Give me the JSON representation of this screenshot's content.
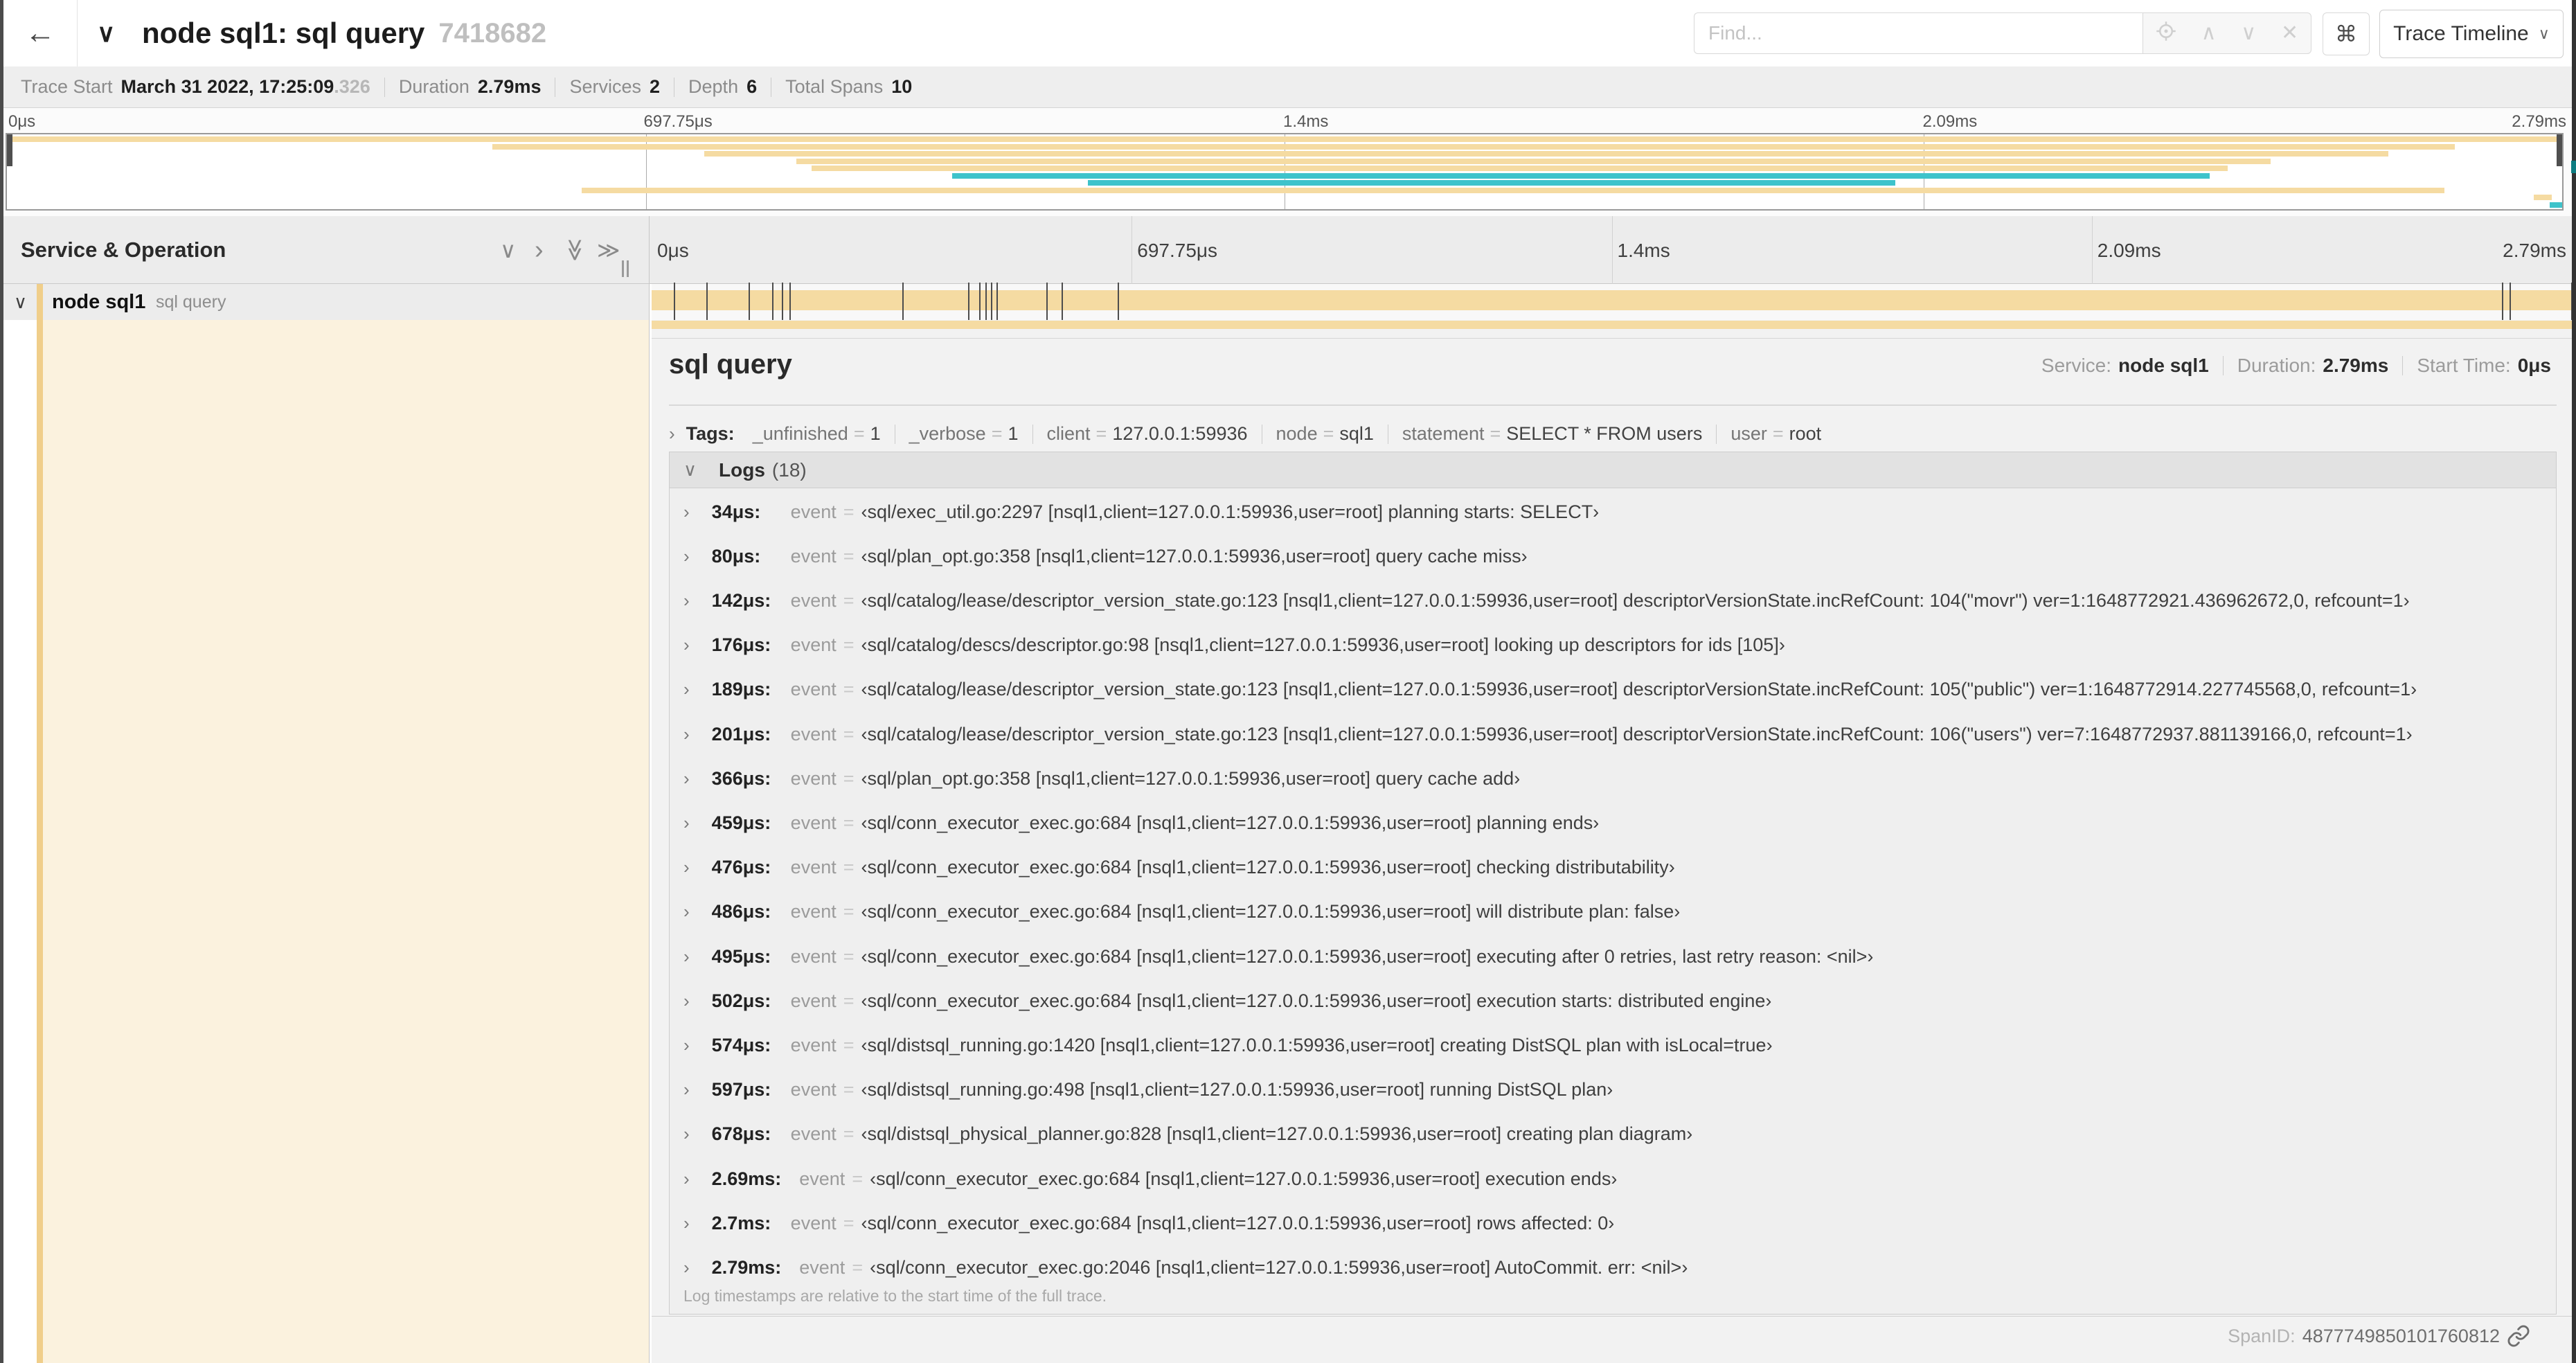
{
  "colors": {
    "tan": "#F5DBA2",
    "teal": "#3EC3CB",
    "accent_strip": "#F0CE8A",
    "detail_tint": "#FBF2DE"
  },
  "header": {
    "back_icon": "←",
    "title": "node sql1: sql query",
    "trace_id": "7418682",
    "find_placeholder": "Find...",
    "view_button_label": "Trace Timeline"
  },
  "stats": {
    "items": [
      {
        "label": "Trace Start",
        "value": "March 31 2022, 17:25:09",
        "suffix": ".326"
      },
      {
        "label": "Duration",
        "value": "2.79ms"
      },
      {
        "label": "Services",
        "value": "2"
      },
      {
        "label": "Depth",
        "value": "6"
      },
      {
        "label": "Total Spans",
        "value": "10"
      }
    ]
  },
  "ruler": {
    "ticks": [
      "0μs",
      "697.75μs",
      "1.4ms",
      "2.09ms",
      "2.79ms"
    ],
    "tick_pcts": [
      0,
      25,
      50,
      75,
      100
    ]
  },
  "minimap": {
    "spans": [
      {
        "start": 0,
        "end": 100,
        "color": "tan"
      },
      {
        "start": 19,
        "end": 95.8,
        "color": "tan"
      },
      {
        "start": 27.3,
        "end": 93.2,
        "color": "tan"
      },
      {
        "start": 30.9,
        "end": 88.6,
        "color": "tan"
      },
      {
        "start": 31.5,
        "end": 86.9,
        "color": "tan"
      },
      {
        "start": 37.0,
        "end": 86.2,
        "color": "teal"
      },
      {
        "start": 42.3,
        "end": 73.9,
        "color": "teal"
      },
      {
        "start": 22.5,
        "end": 95.4,
        "color": "tan"
      },
      {
        "start": 98.9,
        "end": 99.6,
        "color": "tan"
      },
      {
        "start": 99.5,
        "end": 100,
        "color": "teal"
      }
    ]
  },
  "panel": {
    "title": "Service & Operation"
  },
  "row": {
    "service": "node sql1",
    "operation": "sql query"
  },
  "detail": {
    "title": "sql query",
    "meta": [
      {
        "label": "Service:",
        "value": "node sql1"
      },
      {
        "label": "Duration:",
        "value": "2.79ms"
      },
      {
        "label": "Start Time:",
        "value": "0μs"
      }
    ],
    "tags_label": "Tags:",
    "tags": [
      {
        "key": "_unfinished",
        "value": "1"
      },
      {
        "key": "_verbose",
        "value": "1"
      },
      {
        "key": "client",
        "value": "127.0.0.1:59936"
      },
      {
        "key": "node",
        "value": "sql1"
      },
      {
        "key": "statement",
        "value": "SELECT * FROM users"
      },
      {
        "key": "user",
        "value": "root"
      }
    ],
    "logs_label": "Logs",
    "logs_count": "(18)",
    "logs": [
      {
        "time": "34μs:",
        "pct": 1.2,
        "field": "event",
        "value": "‹sql/exec_util.go:2297 [nsql1,client=127.0.0.1:59936,user=root] planning starts: SELECT›"
      },
      {
        "time": "80μs:",
        "pct": 2.9,
        "field": "event",
        "value": "‹sql/plan_opt.go:358 [nsql1,client=127.0.0.1:59936,user=root] query cache miss›"
      },
      {
        "time": "142μs:",
        "pct": 5.1,
        "field": "event",
        "value": "‹sql/catalog/lease/descriptor_version_state.go:123 [nsql1,client=127.0.0.1:59936,user=root] descriptorVersionState.incRefCount: 104(\"movr\") ver=1:1648772921.436962672,0, refcount=1›"
      },
      {
        "time": "176μs:",
        "pct": 6.3,
        "field": "event",
        "value": "‹sql/catalog/descs/descriptor.go:98 [nsql1,client=127.0.0.1:59936,user=root] looking up descriptors for ids [105]›"
      },
      {
        "time": "189μs:",
        "pct": 6.8,
        "field": "event",
        "value": "‹sql/catalog/lease/descriptor_version_state.go:123 [nsql1,client=127.0.0.1:59936,user=root] descriptorVersionState.incRefCount: 105(\"public\") ver=1:1648772914.227745568,0, refcount=1›"
      },
      {
        "time": "201μs:",
        "pct": 7.2,
        "field": "event",
        "value": "‹sql/catalog/lease/descriptor_version_state.go:123 [nsql1,client=127.0.0.1:59936,user=root] descriptorVersionState.incRefCount: 106(\"users\") ver=7:1648772937.881139166,0, refcount=1›"
      },
      {
        "time": "366μs:",
        "pct": 13.1,
        "field": "event",
        "value": "‹sql/plan_opt.go:358 [nsql1,client=127.0.0.1:59936,user=root] query cache add›"
      },
      {
        "time": "459μs:",
        "pct": 16.5,
        "field": "event",
        "value": "‹sql/conn_executor_exec.go:684 [nsql1,client=127.0.0.1:59936,user=root] planning ends›"
      },
      {
        "time": "476μs:",
        "pct": 17.1,
        "field": "event",
        "value": "‹sql/conn_executor_exec.go:684 [nsql1,client=127.0.0.1:59936,user=root] checking distributability›"
      },
      {
        "time": "486μs:",
        "pct": 17.4,
        "field": "event",
        "value": "‹sql/conn_executor_exec.go:684 [nsql1,client=127.0.0.1:59936,user=root] will distribute plan: false›"
      },
      {
        "time": "495μs:",
        "pct": 17.7,
        "field": "event",
        "value": "‹sql/conn_executor_exec.go:684 [nsql1,client=127.0.0.1:59936,user=root] executing after 0 retries, last retry reason: <nil>›"
      },
      {
        "time": "502μs:",
        "pct": 18.0,
        "field": "event",
        "value": "‹sql/conn_executor_exec.go:684 [nsql1,client=127.0.0.1:59936,user=root] execution starts: distributed engine›"
      },
      {
        "time": "574μs:",
        "pct": 20.6,
        "field": "event",
        "value": "‹sql/distsql_running.go:1420 [nsql1,client=127.0.0.1:59936,user=root] creating DistSQL plan with isLocal=true›"
      },
      {
        "time": "597μs:",
        "pct": 21.4,
        "field": "event",
        "value": "‹sql/distsql_running.go:498 [nsql1,client=127.0.0.1:59936,user=root] running DistSQL plan›"
      },
      {
        "time": "678μs:",
        "pct": 24.3,
        "field": "event",
        "value": "‹sql/distsql_physical_planner.go:828 [nsql1,client=127.0.0.1:59936,user=root] creating plan diagram›"
      },
      {
        "time": "2.69ms:",
        "pct": 96.4,
        "field": "event",
        "value": "‹sql/conn_executor_exec.go:684 [nsql1,client=127.0.0.1:59936,user=root] execution ends›"
      },
      {
        "time": "2.7ms:",
        "pct": 96.8,
        "field": "event",
        "value": "‹sql/conn_executor_exec.go:684 [nsql1,client=127.0.0.1:59936,user=root] rows affected: 0›"
      },
      {
        "time": "2.79ms:",
        "pct": 100,
        "field": "event",
        "value": "‹sql/conn_executor_exec.go:2046 [nsql1,client=127.0.0.1:59936,user=root] AutoCommit. err: <nil>›"
      }
    ],
    "footer_note": "Log timestamps are relative to the start time of the full trace.",
    "spanid_label": "SpanID:",
    "spanid_value": "4877749850101760812"
  }
}
